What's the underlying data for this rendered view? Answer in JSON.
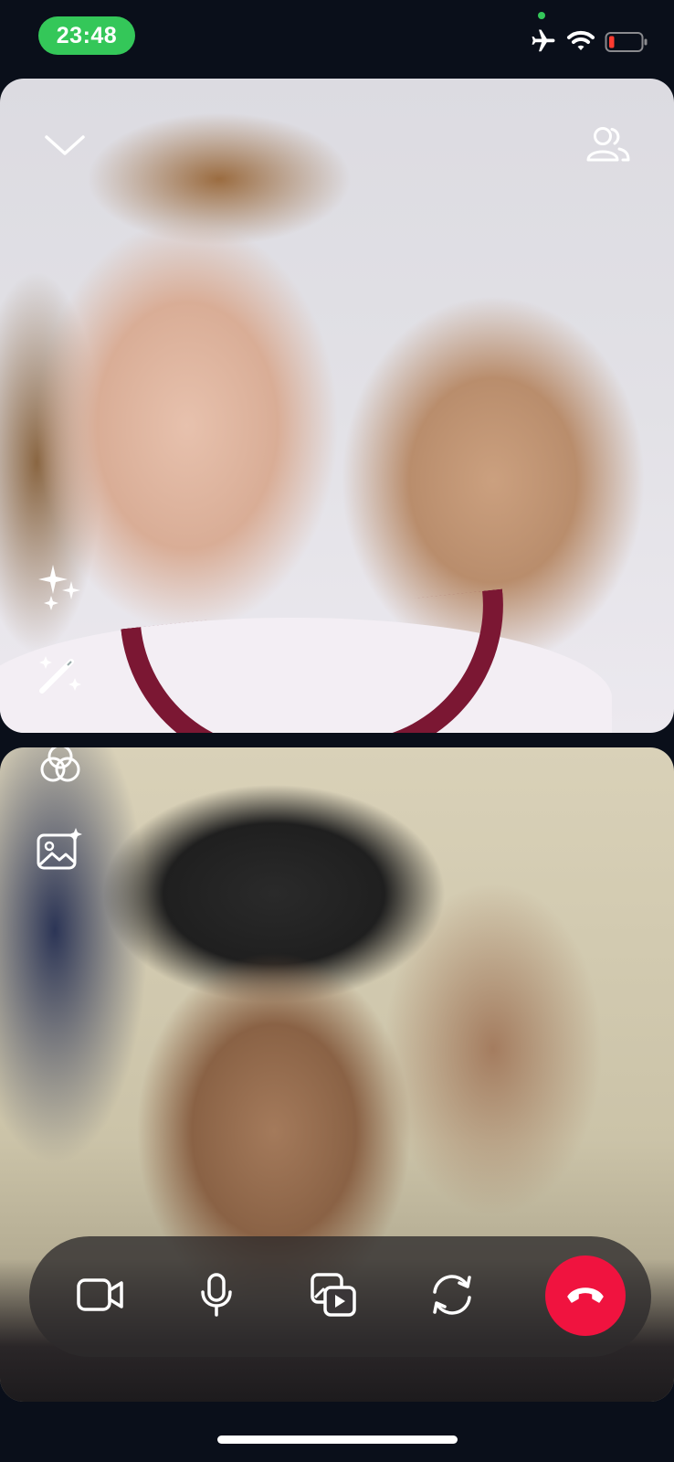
{
  "status_bar": {
    "time": "23:48",
    "icons": [
      "airplane-icon",
      "wifi-icon",
      "battery-low-icon"
    ],
    "battery_level": 0.15,
    "accent_color": "#34c759"
  },
  "remote_video": {
    "overlay_icons": [
      "chevron-down-icon",
      "participants-icon",
      "sparkles-icon",
      "magic-wand-icon"
    ]
  },
  "local_video": {
    "overlay_icons": [
      "filters-icon",
      "background-image-icon"
    ]
  },
  "controls": {
    "buttons": [
      "video-camera-icon",
      "microphone-icon",
      "share-media-icon",
      "flip-camera-icon",
      "end-call-icon"
    ],
    "end_call_color": "#f0133f"
  }
}
